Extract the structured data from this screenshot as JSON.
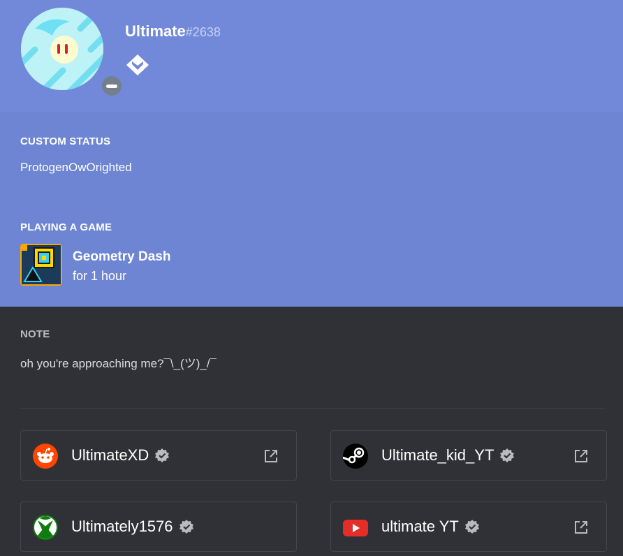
{
  "profile": {
    "username": "Ultimate",
    "discriminator": "#2638",
    "status": "dnd",
    "badge_icon": "hypesquad-icon"
  },
  "custom_status": {
    "title": "CUSTOM STATUS",
    "text": "ProtogenOwOrighted"
  },
  "activity": {
    "title": "PLAYING A GAME",
    "game_name": "Geometry Dash",
    "duration": "for 1 hour"
  },
  "note": {
    "title": "NOTE",
    "text": "oh you're approaching me?¯\\_(ツ)_/¯"
  },
  "connected_accounts": [
    {
      "service": "reddit",
      "name": "UltimateXD",
      "verified": true,
      "icon": "reddit-icon"
    },
    {
      "service": "steam",
      "name": "Ultimate_kid_YT",
      "verified": true,
      "icon": "steam-icon"
    },
    {
      "service": "xbox",
      "name": "Ultimately1576",
      "verified": true,
      "icon": "xbox-icon"
    },
    {
      "service": "youtube",
      "name": "ultimate YT",
      "verified": true,
      "icon": "youtube-icon"
    }
  ],
  "colors": {
    "header": "#7289da",
    "activity": "#6e85d3",
    "body": "#2f3136",
    "reddit": "#ff4500",
    "youtube": "#e52d27",
    "xbox_green": "#107c10",
    "verified": "#b9bbbe"
  }
}
